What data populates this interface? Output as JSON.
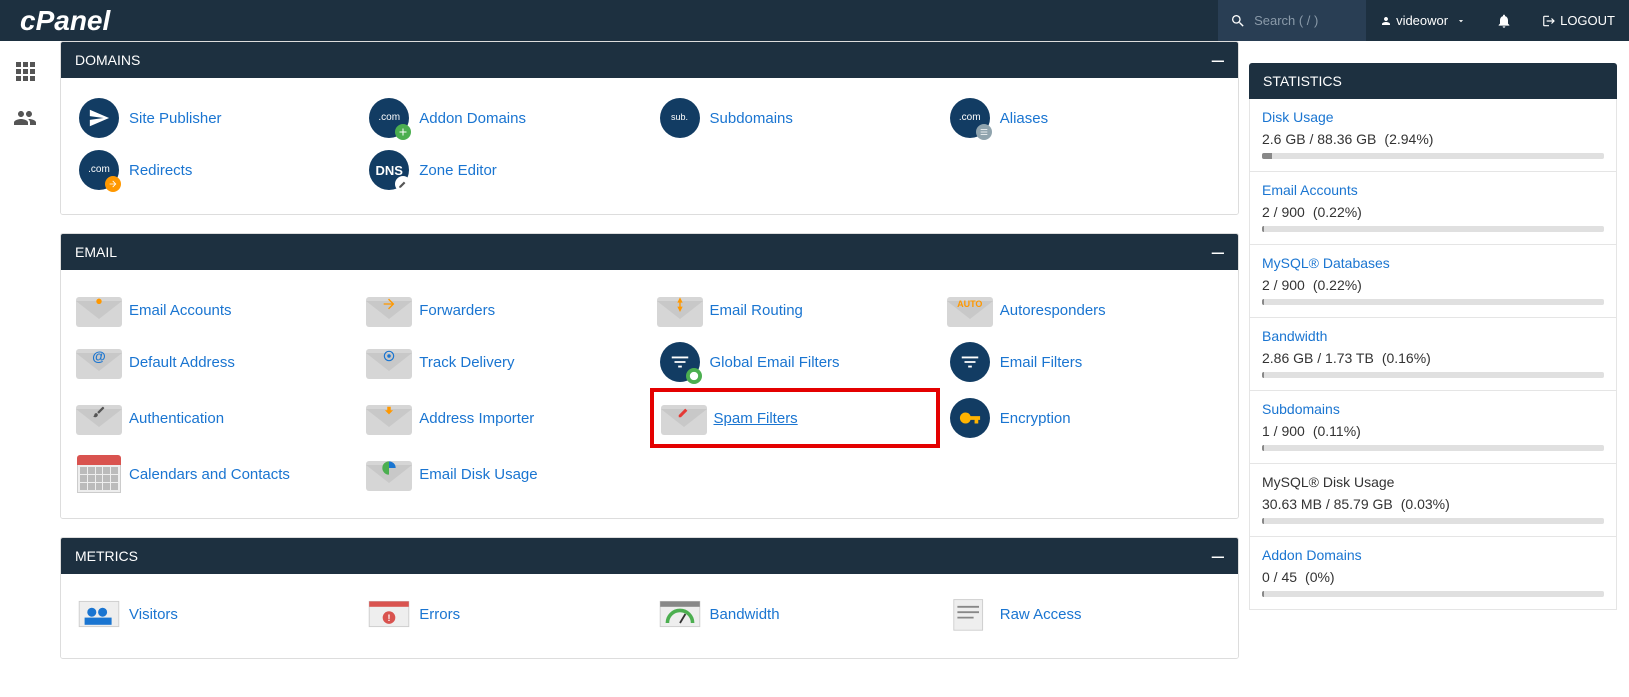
{
  "topbar": {
    "logo": "cPanel",
    "search_placeholder": "Search ( / )",
    "username": "videowor",
    "logout": "LOGOUT"
  },
  "panels": {
    "domains": {
      "title": "DOMAINS",
      "items": [
        {
          "label": "Site Publisher",
          "icon": "site-publisher"
        },
        {
          "label": "Addon Domains",
          "icon": "addon-domains"
        },
        {
          "label": "Subdomains",
          "icon": "subdomains"
        },
        {
          "label": "Aliases",
          "icon": "aliases"
        },
        {
          "label": "Redirects",
          "icon": "redirects"
        },
        {
          "label": "Zone Editor",
          "icon": "zone-editor"
        }
      ]
    },
    "email": {
      "title": "EMAIL",
      "items": [
        {
          "label": "Email Accounts",
          "icon": "email-accounts"
        },
        {
          "label": "Forwarders",
          "icon": "forwarders"
        },
        {
          "label": "Email Routing",
          "icon": "email-routing"
        },
        {
          "label": "Autoresponders",
          "icon": "autoresponders"
        },
        {
          "label": "Default Address",
          "icon": "default-address"
        },
        {
          "label": "Track Delivery",
          "icon": "track-delivery"
        },
        {
          "label": "Global Email Filters",
          "icon": "global-filters"
        },
        {
          "label": "Email Filters",
          "icon": "email-filters"
        },
        {
          "label": "Authentication",
          "icon": "authentication"
        },
        {
          "label": "Address Importer",
          "icon": "address-importer"
        },
        {
          "label": "Spam Filters",
          "icon": "spam-filters",
          "highlight": true
        },
        {
          "label": "Encryption",
          "icon": "encryption"
        },
        {
          "label": "Calendars and Contacts",
          "icon": "calendars"
        },
        {
          "label": "Email Disk Usage",
          "icon": "email-disk"
        }
      ]
    },
    "metrics": {
      "title": "METRICS",
      "items": [
        {
          "label": "Visitors",
          "icon": "visitors"
        },
        {
          "label": "Errors",
          "icon": "errors"
        },
        {
          "label": "Bandwidth",
          "icon": "bandwidth"
        },
        {
          "label": "Raw Access",
          "icon": "raw-access"
        }
      ]
    }
  },
  "stats": {
    "title": "STATISTICS",
    "items": [
      {
        "title": "Disk Usage",
        "value": "2.6 GB / 88.36 GB",
        "pct": "(2.94%)",
        "bar": 2.94,
        "link": true
      },
      {
        "title": "Email Accounts",
        "value": "2 / 900",
        "pct": "(0.22%)",
        "bar": 0.22,
        "link": true
      },
      {
        "title": "MySQL® Databases",
        "value": "2 / 900",
        "pct": "(0.22%)",
        "bar": 0.22,
        "link": true
      },
      {
        "title": "Bandwidth",
        "value": "2.86 GB / 1.73 TB",
        "pct": "(0.16%)",
        "bar": 0.16,
        "link": true
      },
      {
        "title": "Subdomains",
        "value": "1 / 900",
        "pct": "(0.11%)",
        "bar": 0.11,
        "link": true
      },
      {
        "title": "MySQL® Disk Usage",
        "value": "30.63 MB / 85.79 GB",
        "pct": "(0.03%)",
        "bar": 0.03,
        "link": false
      },
      {
        "title": "Addon Domains",
        "value": "0 / 45",
        "pct": "(0%)",
        "bar": 0,
        "link": true
      }
    ]
  }
}
